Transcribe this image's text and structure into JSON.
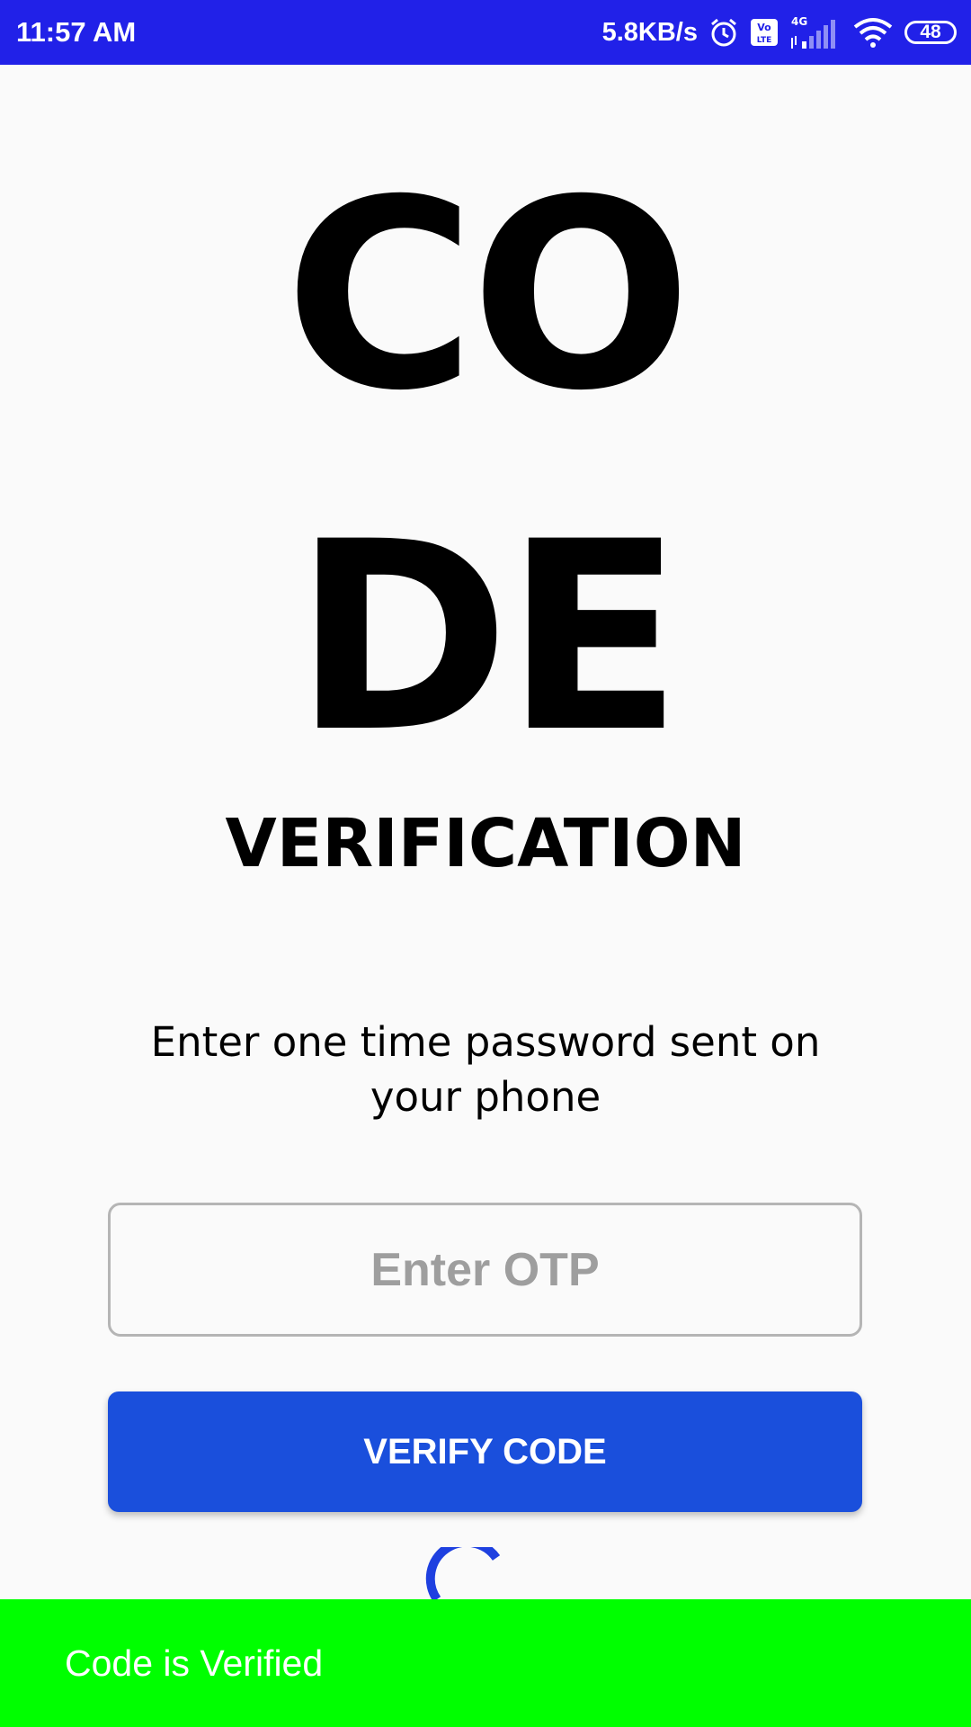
{
  "status_bar": {
    "time": "11:57 AM",
    "net_speed": "5.8KB/s",
    "battery_level": "48",
    "network_type": "4G",
    "icons": [
      "alarm-icon",
      "volte-icon",
      "signal-icon",
      "wifi-icon",
      "battery-icon"
    ]
  },
  "title": {
    "line1": "CO",
    "line2": "DE",
    "subtitle": "VERIFICATION"
  },
  "instruction": "Enter one time password sent on your phone",
  "otp_input": {
    "placeholder": "Enter OTP",
    "value": ""
  },
  "verify_button": {
    "label": "VERIFY CODE"
  },
  "snackbar": {
    "message": "Code is Verified"
  },
  "colors": {
    "status_bar": "#2121e8",
    "button": "#1a4fdc",
    "spinner": "#1e40e0",
    "snackbar": "#00ff00",
    "background": "#fafafa"
  }
}
